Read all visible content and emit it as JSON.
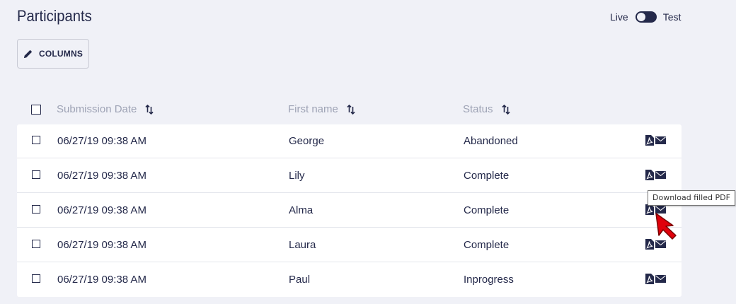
{
  "page": {
    "title": "Participants"
  },
  "environment_toggle": {
    "left_label": "Live",
    "right_label": "Test",
    "selected": "Live"
  },
  "toolbar": {
    "columns_label": "COLUMNS"
  },
  "table": {
    "headers": {
      "submission_date": "Submission Date",
      "first_name": "First name",
      "status": "Status"
    },
    "rows": [
      {
        "date": "06/27/19 09:38 AM",
        "first_name": "George",
        "status": "Abandoned"
      },
      {
        "date": "06/27/19 09:38 AM",
        "first_name": "Lily",
        "status": "Complete"
      },
      {
        "date": "06/27/19 09:38 AM",
        "first_name": "Alma",
        "status": "Complete"
      },
      {
        "date": "06/27/19 09:38 AM",
        "first_name": "Laura",
        "status": "Complete"
      },
      {
        "date": "06/27/19 09:38 AM",
        "first_name": "Paul",
        "status": "Inprogress"
      }
    ],
    "row_actions": [
      "pdf-icon",
      "mail-icon"
    ]
  },
  "tooltip": {
    "text": "Download filled PDF"
  },
  "colors": {
    "background": "#f0f1f7",
    "primary": "#24294a",
    "muted_header": "#9ea3b5",
    "row_background": "#ffffff",
    "cursor": "#e0000b"
  }
}
